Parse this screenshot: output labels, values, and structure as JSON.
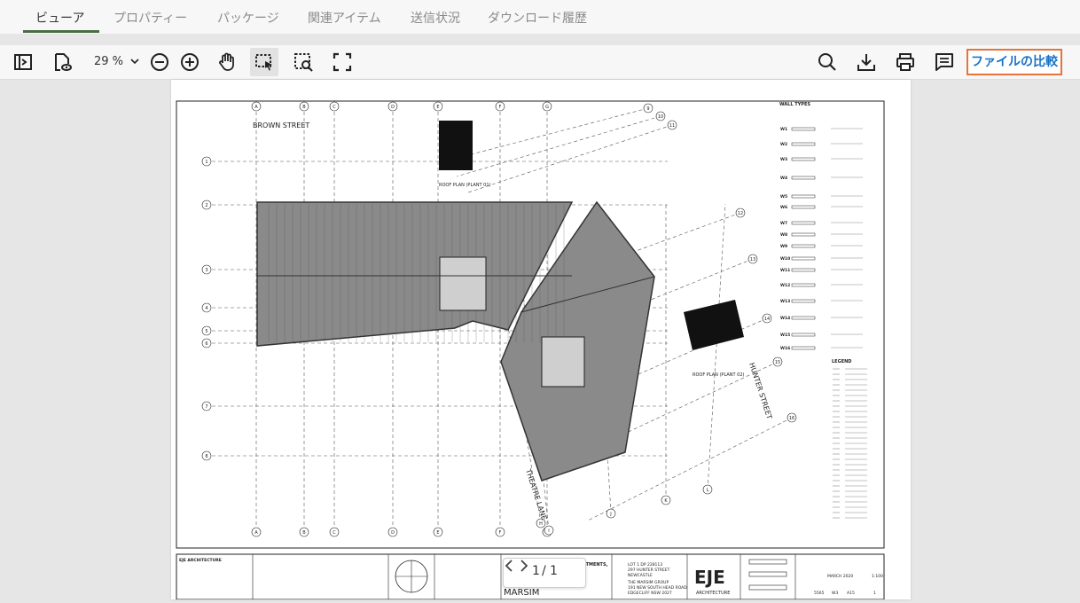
{
  "tabs": [
    {
      "label": "ビューア",
      "active": true
    },
    {
      "label": "プロパティー"
    },
    {
      "label": "パッケージ"
    },
    {
      "label": "関連アイテム"
    },
    {
      "label": "送信状況"
    },
    {
      "label": "ダウンロード履歴"
    }
  ],
  "toolbar": {
    "zoom": "29 %",
    "compare_label": "ファイルの比較"
  },
  "drawing": {
    "street_left": "BROWN STREET",
    "street_right": "HUNTER STREET",
    "street_bottom": "THEATRE LANE",
    "roof_plan_1": "ROOF PLAN (PLANT 01)",
    "roof_plan_2": "ROOF PLAN (PLANT 02)",
    "wall_types": "WALL TYPES",
    "legend": "LEGEND",
    "grid_cols": [
      "A",
      "B",
      "C",
      "D",
      "E",
      "F",
      "G"
    ],
    "grid_rows": [
      "1",
      "2",
      "3",
      "4",
      "5",
      "6",
      "7",
      "8"
    ],
    "grid_diag": [
      "9",
      "10",
      "11",
      "12",
      "13",
      "14",
      "15",
      "16"
    ],
    "grid_bottom": [
      "H",
      "I",
      "J",
      "K",
      "L"
    ],
    "wall_codes": [
      "W1",
      "W2",
      "W3",
      "W4",
      "W5",
      "W6",
      "W7",
      "W8",
      "W9",
      "W10",
      "W11",
      "W12",
      "W13",
      "W14",
      "W15",
      "W16"
    ],
    "title_firm": "EJE ARCHITECTURE",
    "title_apartments": "APARTMENTS,",
    "title_project": "MARSIM",
    "title_lot": "LOT 1 DP 228113",
    "title_address1": "297 HUNTER STREET",
    "title_address2": "NEWCASTLE",
    "title_client1": "THE MARSIM GROUP",
    "title_client2": "191 NEW SOUTH HEAD ROAD",
    "title_client3": "EDGECLIFF NSW 2027",
    "logo": "EJE",
    "logo_sub": "ARCHITECTURE",
    "date": "MARCH 2020",
    "scale": "1:100",
    "drawing_no": "A15",
    "issue": "1",
    "project_no": "5565",
    "w_code": "W3"
  },
  "pager": {
    "current": "1",
    "separator": "/",
    "total": "1"
  }
}
